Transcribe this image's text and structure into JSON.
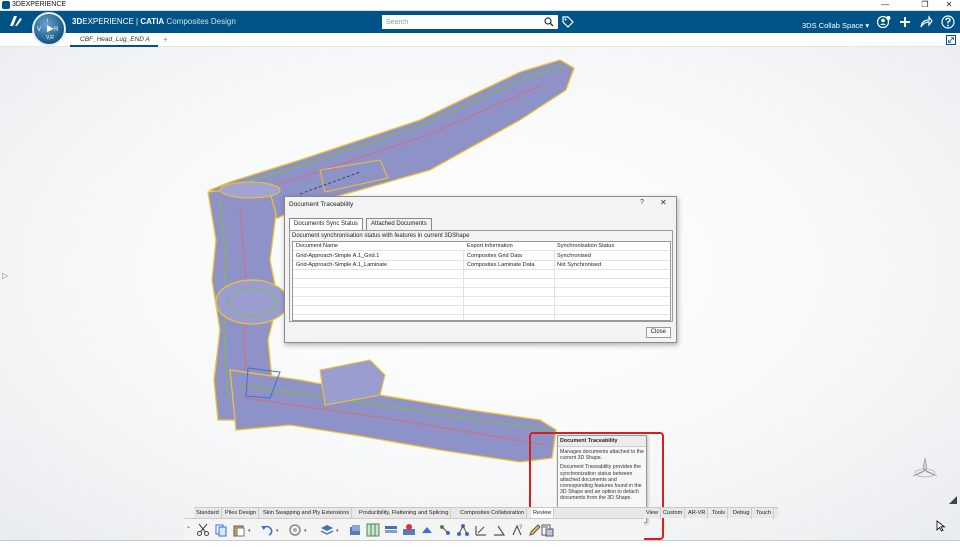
{
  "os": {
    "title": "3DEXPERIENCE",
    "minimize": "—",
    "restore": "❐",
    "close": "✕"
  },
  "top_bar": {
    "brand_prefix": "3D",
    "brand_rest": "EXPERIENCE",
    "brand_sep": " | ",
    "brand_product": "CATIA",
    "brand_app": " Composites Design",
    "compass": {
      "v": "V",
      "r": "R",
      "i": "i",
      "vr": "V,R"
    },
    "search_placeholder": "Search",
    "collab_space": "3DS Collab Space ▾"
  },
  "tabs": {
    "document_tab": "CBF_Head_Lug_END A",
    "add": "+"
  },
  "dialog": {
    "title": "Document Traceability",
    "help": "?",
    "close_x": "✕",
    "tabs": [
      "Documents Sync Status",
      "Attached Documents"
    ],
    "description": "Document synchronisation status with features in current 3DShape",
    "columns": [
      "Document Name",
      "Export Information",
      "Synchronisation Status"
    ],
    "rows": [
      [
        "Grid-Approach-Simple A.1_Grid.1",
        "Composites Grid Data",
        "Synchronised"
      ],
      [
        "Grid-Approach-Simple A.1_Laminate",
        "Composites Laminate Data",
        "Not Synchronised"
      ]
    ],
    "close_button": "Close"
  },
  "tooltip": {
    "title": "Document Traceability",
    "line1": "Manages documents attached to the current 3D Shape.",
    "line2": "Document Traceability provides the synchronization status between attached documents and corresponding features found in the 3D Shape and an option to detach documents from the 3D Shape."
  },
  "section_tabs": [
    "Standard",
    "Plies Design",
    "Skin Swapping and Ply Extensions",
    "Producibility, Flattening and Splicing",
    "Composites Collaboration",
    "Review",
    "View",
    "Custom",
    "AR-VR",
    "Tools",
    "Debug",
    "Touch"
  ],
  "colors": {
    "brand_blue": "#005386",
    "model_fill": "#8f92c6",
    "highlight_red": "#d62020"
  }
}
